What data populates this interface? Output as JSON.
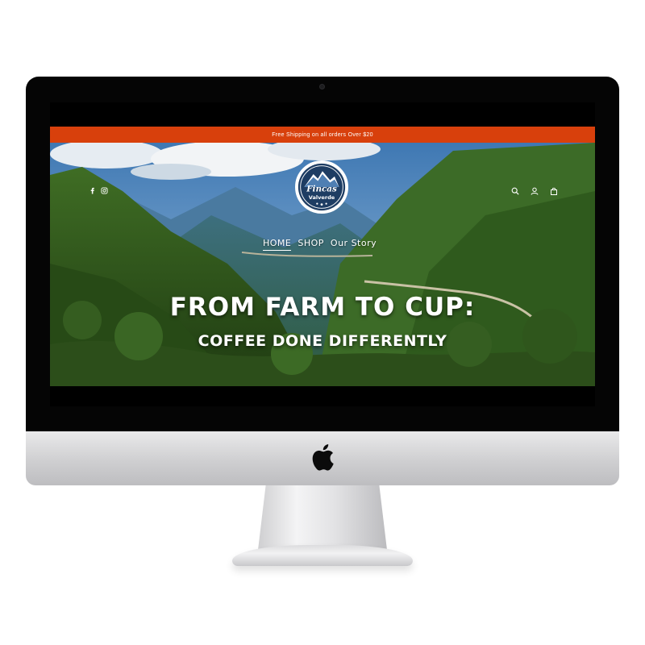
{
  "announcement": {
    "text": "Free Shipping on all orders Over $20",
    "background": "#d8400c"
  },
  "header": {
    "social_icons": [
      "facebook-icon",
      "instagram-icon"
    ],
    "logo": {
      "line1": "Fincas",
      "line2": "Valverde"
    },
    "utility_icons": [
      "search-icon",
      "account-icon",
      "cart-icon"
    ]
  },
  "nav": {
    "items": [
      {
        "label": "HOME",
        "active": true
      },
      {
        "label": "SHOP",
        "active": false
      },
      {
        "label": "Our Story",
        "active": false
      }
    ]
  },
  "hero": {
    "headline": "FROM FARM TO CUP:",
    "subheadline": "COFFEE DONE DIFFERENTLY"
  },
  "device": {
    "brand_icon": "apple-icon"
  }
}
